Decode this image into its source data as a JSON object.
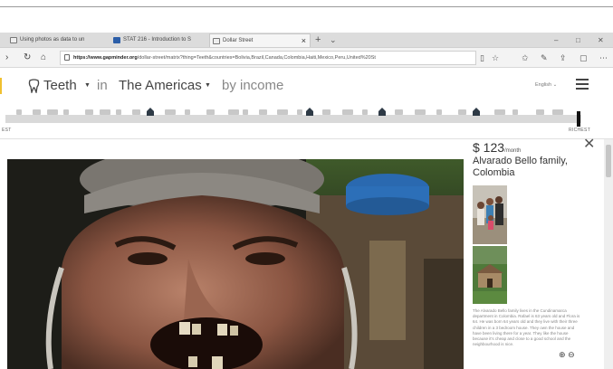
{
  "browser": {
    "tabs": [
      {
        "label": "Using photos as data to un",
        "icon": "page-icon"
      },
      {
        "label": "STAT 216 - Introduction to S",
        "icon": "app-icon"
      },
      {
        "label": "Dollar Street",
        "icon": "page-icon",
        "active": true
      }
    ],
    "new_tab": "+",
    "tab_list": "⌄",
    "window": {
      "minimize": "–",
      "maximize": "□",
      "close": "✕"
    },
    "nav": {
      "back": "›",
      "refresh": "↻",
      "home": "⌂"
    },
    "url_host": "https://www.gapminder.org",
    "url_path": "/dollar-street/matrix?thing=Teeth&countries=Bolivia,Brazil,Canada,Colombia,Haiti,Mexico,Peru,United%20St"
  },
  "toolbar": {
    "thing": "Teeth",
    "in": "in",
    "region": "The Americas",
    "by": "by income",
    "language": "English"
  },
  "slider": {
    "left_label": "EST",
    "right_label": "RICHEST",
    "handle_value": 0.995
  },
  "panel": {
    "price": "$ 123",
    "per": "/month",
    "family": "Alvarado Bello family, Colombia",
    "description": "The Alvarado Bello family lives in the Cundinamarca department in Colombia. Rafael is 63 years old and Flora is 64. He was born 64 years old and they live with their three children in a 3 bedroom house. They own the house and have been living there for a year. They like the house because it's cheap and close to a good school and the neighbourhood is nice."
  },
  "colors": {
    "accent_yellow": "#f0c030",
    "slider_house": "#2e3a46",
    "handle": "#111111"
  }
}
